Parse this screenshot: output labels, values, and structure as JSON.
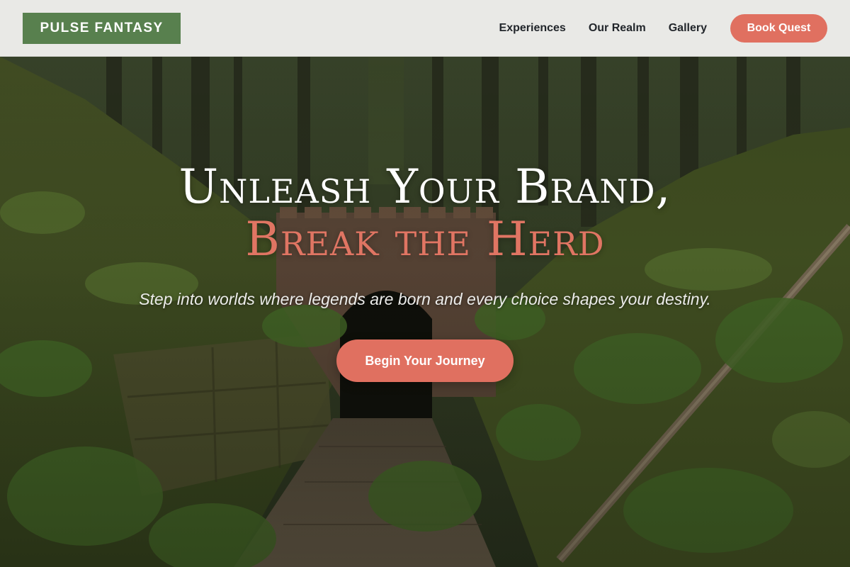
{
  "header": {
    "logo_text": "PULSE FANTASY",
    "nav": [
      "Experiences",
      "Our Realm",
      "Gallery"
    ],
    "cta_label": "Book Quest"
  },
  "hero": {
    "headline_line1": "Unleash Your Brand,",
    "headline_line2": "Break the Herd",
    "tagline": "Step into worlds where legends are born and every choice shapes your destiny.",
    "cta_label": "Begin Your Journey",
    "background": "forest-ruins-tunnel-image"
  },
  "colors": {
    "accent": "#e07060",
    "logo_green": "#58804e",
    "header_bg": "#f0f0ee",
    "text_dark": "#22262b"
  }
}
